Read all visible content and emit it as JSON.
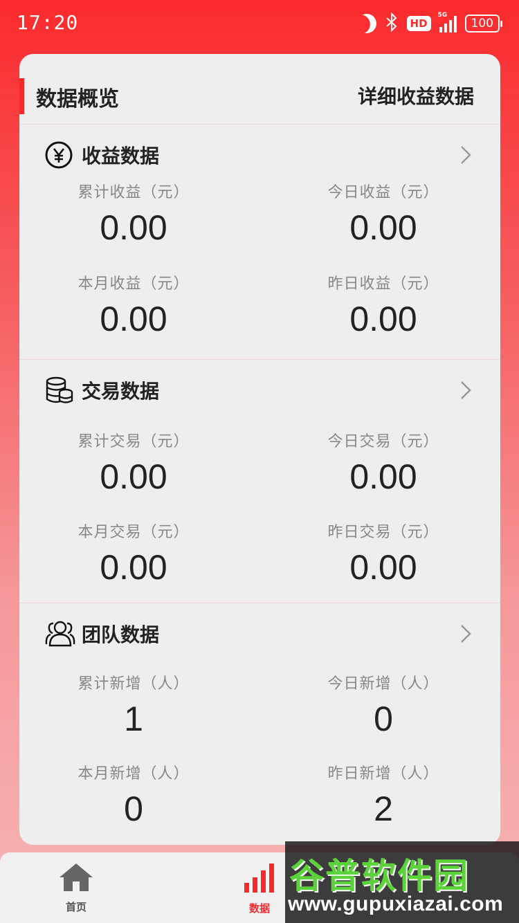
{
  "status_bar": {
    "time": "17:20",
    "hd_badge": "HD",
    "network": "5G",
    "battery": "100"
  },
  "card": {
    "title": "数据概览",
    "detail_link": "详细收益数据"
  },
  "sections": [
    {
      "title": "收益数据",
      "icon": "yen-icon",
      "metrics": [
        {
          "label": "累计收益（元）",
          "value": "0.00"
        },
        {
          "label": "今日收益（元）",
          "value": "0.00"
        },
        {
          "label": "本月收益（元）",
          "value": "0.00"
        },
        {
          "label": "昨日收益（元）",
          "value": "0.00"
        }
      ]
    },
    {
      "title": "交易数据",
      "icon": "coins-icon",
      "metrics": [
        {
          "label": "累计交易（元）",
          "value": "0.00"
        },
        {
          "label": "今日交易（元）",
          "value": "0.00"
        },
        {
          "label": "本月交易（元）",
          "value": "0.00"
        },
        {
          "label": "昨日交易（元）",
          "value": "0.00"
        }
      ]
    },
    {
      "title": "团队数据",
      "icon": "team-icon",
      "metrics": [
        {
          "label": "累计新增（人）",
          "value": "1"
        },
        {
          "label": "今日新增（人）",
          "value": "0"
        },
        {
          "label": "本月新增（人）",
          "value": "0"
        },
        {
          "label": "昨日新增（人）",
          "value": "2"
        }
      ]
    }
  ],
  "bottom_nav": [
    {
      "label": "首页",
      "icon": "home-icon",
      "active": false
    },
    {
      "label": "数据",
      "icon": "bar-chart-icon",
      "active": true
    }
  ],
  "watermark": {
    "brand": "谷普软件园",
    "url": "www.gupuxiazai.com"
  },
  "colors": {
    "accent": "#f42a2c",
    "card_bg": "#eeeeee",
    "watermark_green": "#5bd13a"
  }
}
